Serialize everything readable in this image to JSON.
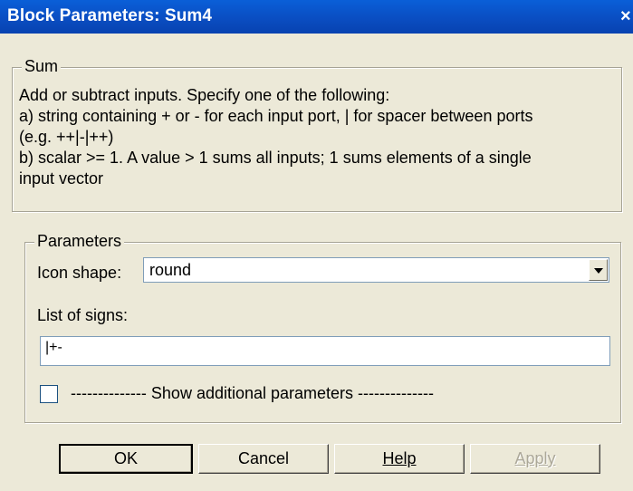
{
  "window": {
    "title": "Block Parameters: Sum4",
    "close_glyph": "×"
  },
  "sum_group": {
    "legend": "Sum",
    "description_lines": [
      "Add or subtract inputs.  Specify one of the following:",
      "a) string containing + or - for each input port, | for spacer between ports",
      "(e.g. ++|-|++)",
      "b) scalar >= 1. A value > 1 sums all inputs; 1 sums elements of a single",
      "input vector"
    ]
  },
  "parameters_group": {
    "legend": "Parameters",
    "icon_shape_label": "Icon shape:",
    "icon_shape_value": "round",
    "list_of_signs_label": "List of signs:",
    "list_of_signs_value": "|+-",
    "show_additional_checked": false,
    "show_additional_label": "-------------- Show additional parameters --------------"
  },
  "buttons": {
    "ok": "OK",
    "cancel": "Cancel",
    "help": "Help",
    "apply": "Apply"
  }
}
